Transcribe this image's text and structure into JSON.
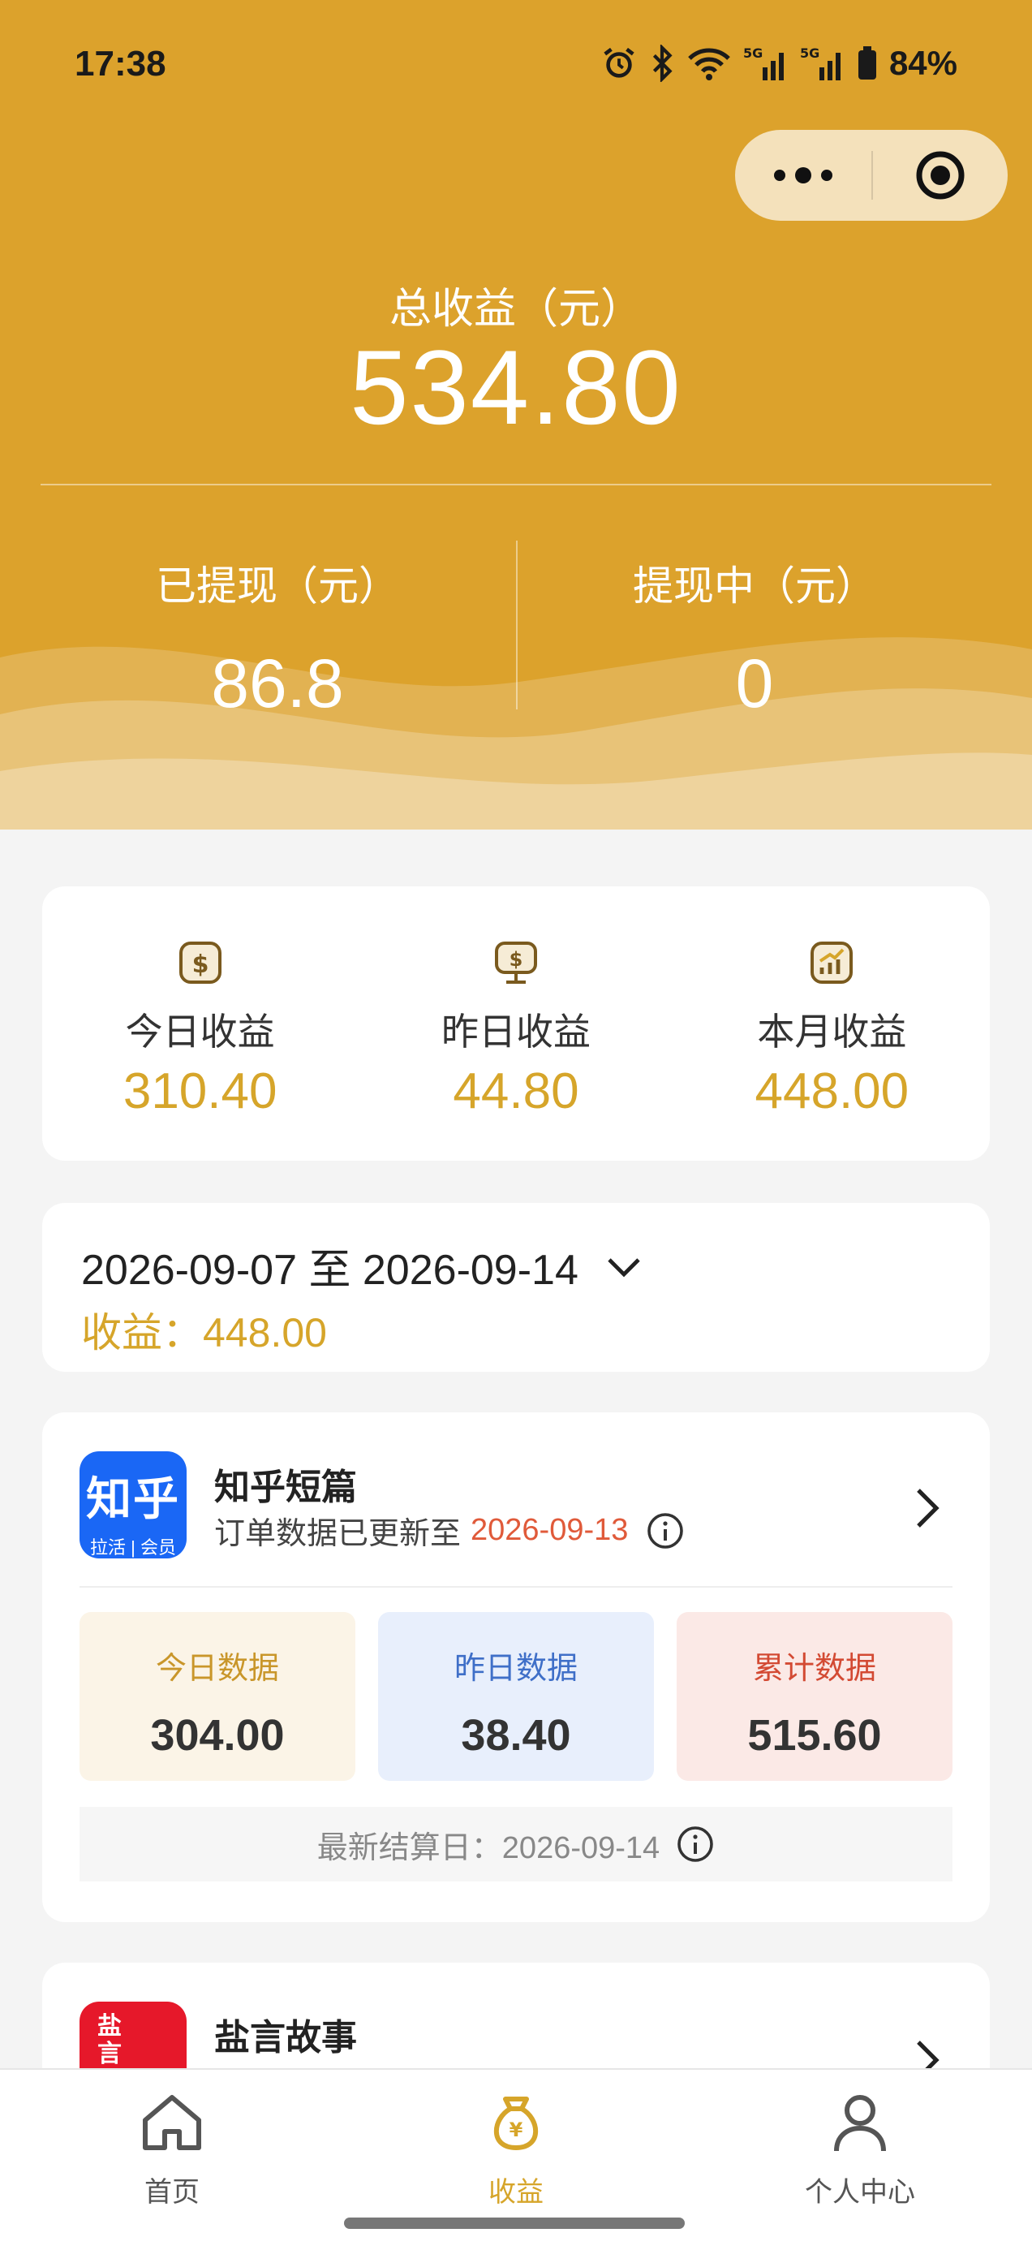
{
  "status_bar": {
    "time": "17:38",
    "battery": "84%",
    "network_1": "5G",
    "network_2": "5G"
  },
  "summary": {
    "total_label": "总收益（元）",
    "total_value": "534.80",
    "withdrawn_label": "已提现（元）",
    "withdrawn_value": "86.8",
    "withdrawing_label": "提现中（元）",
    "withdrawing_value": "0"
  },
  "stats": [
    {
      "label": "今日收益",
      "value": "310.40",
      "icon": "dollar-badge-icon"
    },
    {
      "label": "昨日收益",
      "value": "44.80",
      "icon": "monitor-dollar-icon"
    },
    {
      "label": "本月收益",
      "value": "448.00",
      "icon": "chart-up-icon"
    }
  ],
  "date_filter": {
    "range": "2026-09-07 至 2026-09-14",
    "earnings_label": "收益：",
    "earnings_value": "448.00"
  },
  "platforms": [
    {
      "name": "知乎短篇",
      "logo_main": "知乎",
      "logo_sub": "拉活 | 会员",
      "update_prefix": "订单数据已更新至",
      "update_date": "2026-09-13",
      "today_label": "今日数据",
      "today_value": "304.00",
      "yesterday_label": "昨日数据",
      "yesterday_value": "38.40",
      "total_label": "累计数据",
      "total_value": "515.60",
      "settle_text": "最新结算日：2026-09-14"
    },
    {
      "name": "盐言故事",
      "logo_glyph": "盐言"
    }
  ],
  "tabbar": [
    {
      "label": "首页",
      "icon": "home-icon"
    },
    {
      "label": "收益",
      "icon": "money-bag-icon"
    },
    {
      "label": "个人中心",
      "icon": "person-icon"
    }
  ],
  "colors": {
    "header_bg": "#dca22c",
    "accent_gold": "#d6a52a",
    "update_date_red": "#e05a3a"
  }
}
